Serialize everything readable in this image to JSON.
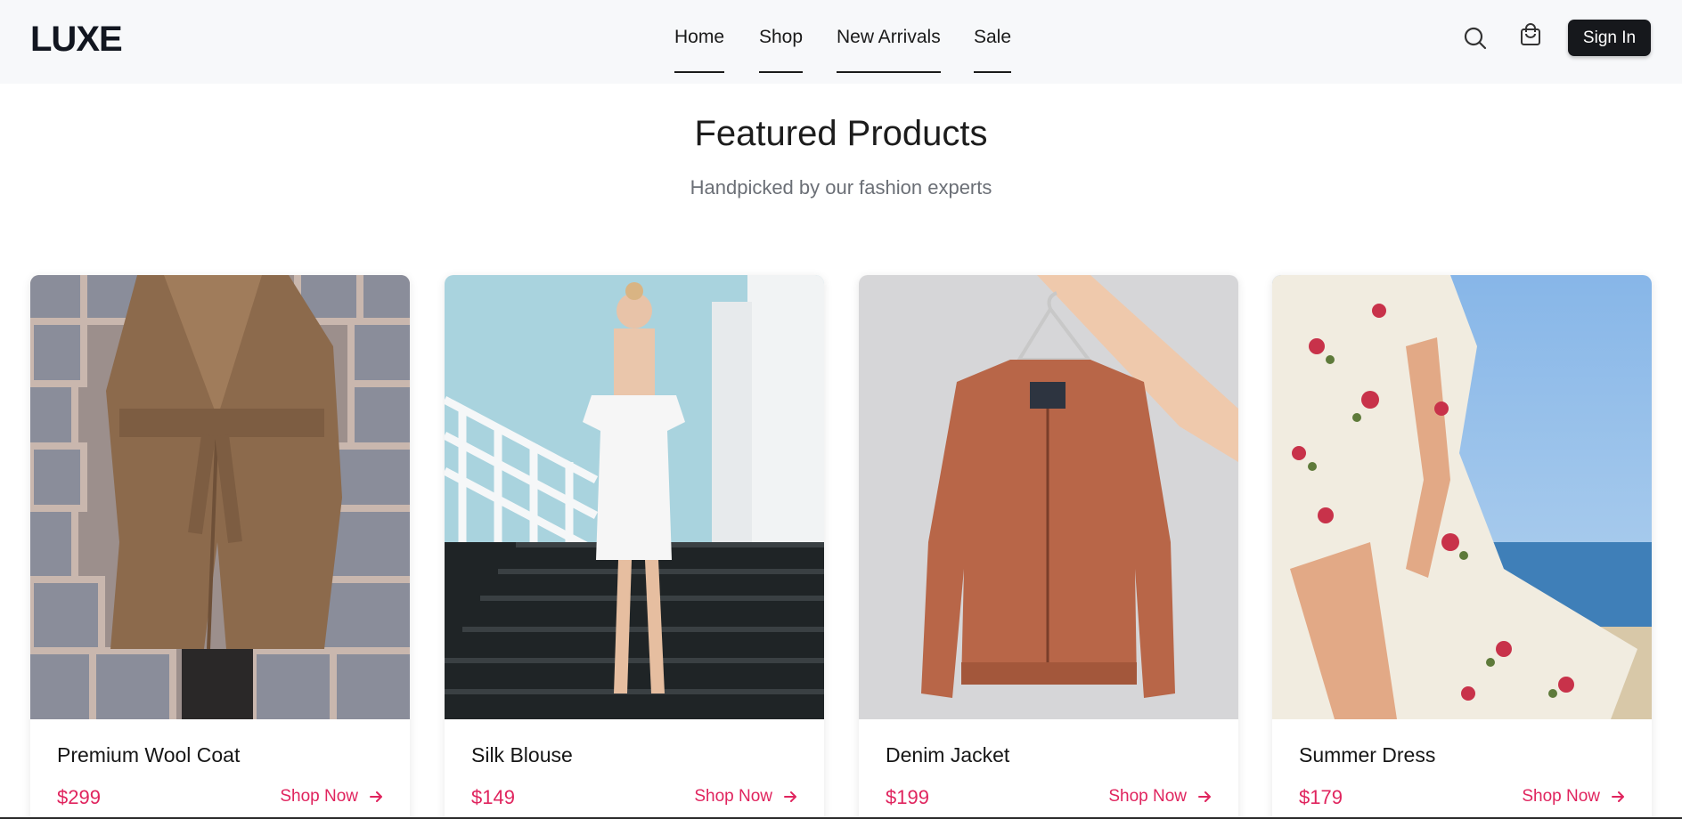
{
  "brand": {
    "logo": "LUXE"
  },
  "nav": {
    "items": [
      {
        "label": "Home"
      },
      {
        "label": "Shop"
      },
      {
        "label": "New Arrivals"
      },
      {
        "label": "Sale"
      }
    ],
    "search_icon": "search-icon",
    "cart_icon": "shopping-bag-icon",
    "signin_label": "Sign In"
  },
  "section": {
    "title": "Featured Products",
    "subtitle": "Handpicked by our fashion experts"
  },
  "products": [
    {
      "name": "Premium Wool Coat",
      "price": "$299",
      "cta": "Shop Now",
      "image": "camel wool coat against stone wall"
    },
    {
      "name": "Silk Blouse",
      "price": "$149",
      "cta": "Shop Now",
      "image": "white off-shoulder dress on stairs"
    },
    {
      "name": "Denim Jacket",
      "price": "$199",
      "cta": "Shop Now",
      "image": "rust bomber jacket on hanger"
    },
    {
      "name": "Summer Dress",
      "price": "$179",
      "cta": "Shop Now",
      "image": "floral wrap dress by the sea"
    }
  ],
  "colors": {
    "accent": "#e0245e",
    "header_bg": "#f7f8fa",
    "button_bg": "#16181c"
  }
}
